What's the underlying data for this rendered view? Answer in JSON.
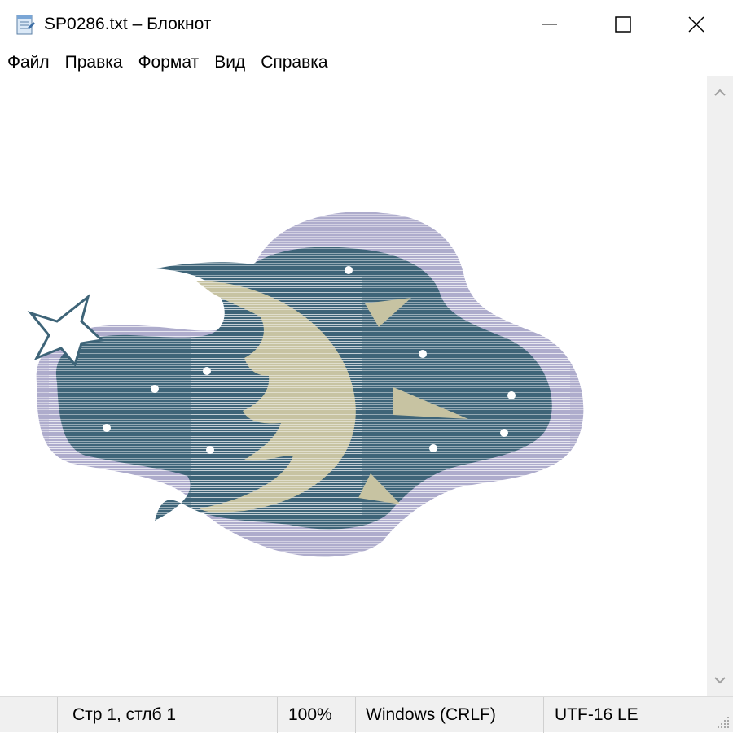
{
  "window": {
    "title": "SP0286.txt – Блокнот",
    "app_icon": "notepad-icon",
    "controls": [
      "minimize-icon",
      "maximize-icon",
      "close-icon"
    ]
  },
  "menu": {
    "items": [
      {
        "label": "Файл"
      },
      {
        "label": "Правка"
      },
      {
        "label": "Формат"
      },
      {
        "label": "Вид"
      },
      {
        "label": "Справка"
      }
    ]
  },
  "editor": {
    "content": "ASCII-art image of a crescent moon face in a night-sky cloud with stars",
    "colors": {
      "halo": "#aeaccc",
      "cloud": "#3e6478",
      "moon": "#c7c3a2",
      "star": "#ffffff"
    }
  },
  "scrollbar": {
    "up_icon": "chevron-up-icon",
    "down_icon": "chevron-down-icon"
  },
  "status": {
    "position": "Стр 1, стлб 1",
    "zoom": "100%",
    "line_endings": "Windows (CRLF)",
    "encoding": "UTF-16 LE"
  }
}
